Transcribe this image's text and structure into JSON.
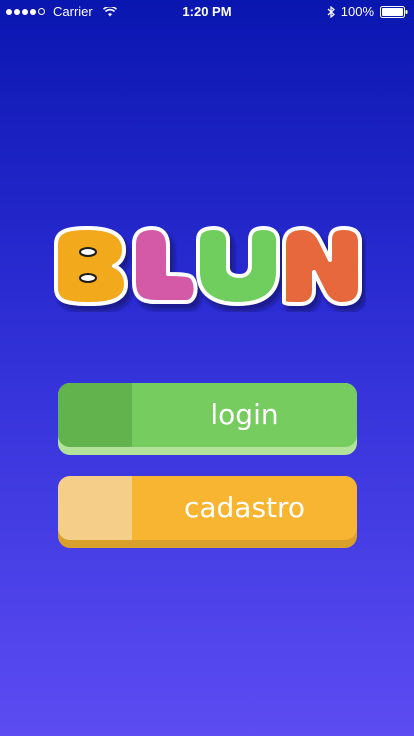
{
  "status_bar": {
    "carrier": "Carrier",
    "time": "1:20 PM",
    "battery": "100%"
  },
  "logo": {
    "text": "BLUN",
    "colors": {
      "B": "#f2a91f",
      "L": "#d45aa8",
      "U": "#6fce5f",
      "N": "#e8683c"
    }
  },
  "buttons": {
    "login_label": "login",
    "register_label": "cadastro"
  },
  "colors": {
    "background_top": "#0a16b0",
    "background_bottom": "#5c4cf2",
    "login": "#76cc5f",
    "register": "#f7b532"
  }
}
